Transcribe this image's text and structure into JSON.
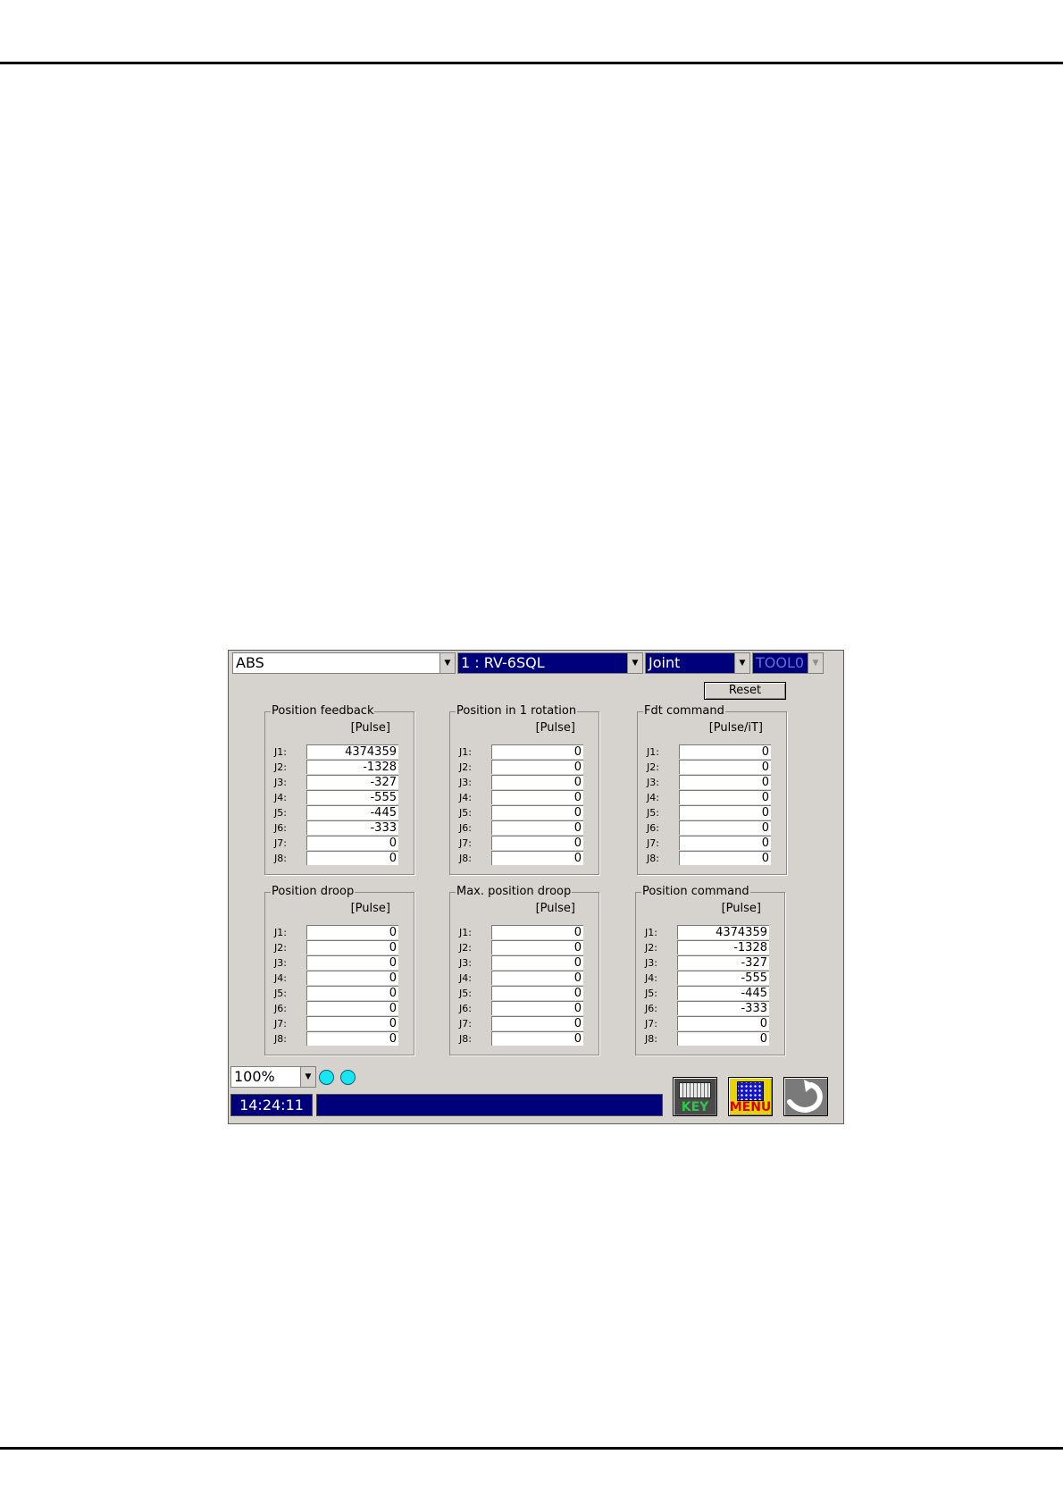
{
  "toolbar": {
    "mode": "ABS",
    "robot": "1 : RV-6SQL",
    "frame": "Joint",
    "tool": "TOOL0"
  },
  "reset_label": "Reset",
  "panels": [
    {
      "title": "Position feedback",
      "unit": "[Pulse]",
      "rows": [
        {
          "label": "J1:",
          "value": "4374359"
        },
        {
          "label": "J2:",
          "value": "-1328"
        },
        {
          "label": "J3:",
          "value": "-327"
        },
        {
          "label": "J4:",
          "value": "-555"
        },
        {
          "label": "J5:",
          "value": "-445"
        },
        {
          "label": "J6:",
          "value": "-333"
        },
        {
          "label": "J7:",
          "value": "0"
        },
        {
          "label": "J8:",
          "value": "0"
        }
      ]
    },
    {
      "title": "Position in 1 rotation",
      "unit": "[Pulse]",
      "rows": [
        {
          "label": "J1:",
          "value": "0"
        },
        {
          "label": "J2:",
          "value": "0"
        },
        {
          "label": "J3:",
          "value": "0"
        },
        {
          "label": "J4:",
          "value": "0"
        },
        {
          "label": "J5:",
          "value": "0"
        },
        {
          "label": "J6:",
          "value": "0"
        },
        {
          "label": "J7:",
          "value": "0"
        },
        {
          "label": "J8:",
          "value": "0"
        }
      ]
    },
    {
      "title": "Fdt command",
      "unit": "[Pulse/iT]",
      "rows": [
        {
          "label": "J1:",
          "value": "0"
        },
        {
          "label": "J2:",
          "value": "0"
        },
        {
          "label": "J3:",
          "value": "0"
        },
        {
          "label": "J4:",
          "value": "0"
        },
        {
          "label": "J5:",
          "value": "0"
        },
        {
          "label": "J6:",
          "value": "0"
        },
        {
          "label": "J7:",
          "value": "0"
        },
        {
          "label": "J8:",
          "value": "0"
        }
      ]
    },
    {
      "title": "Position droop",
      "unit": "[Pulse]",
      "rows": [
        {
          "label": "J1:",
          "value": "0"
        },
        {
          "label": "J2:",
          "value": "0"
        },
        {
          "label": "J3:",
          "value": "0"
        },
        {
          "label": "J4:",
          "value": "0"
        },
        {
          "label": "J5:",
          "value": "0"
        },
        {
          "label": "J6:",
          "value": "0"
        },
        {
          "label": "J7:",
          "value": "0"
        },
        {
          "label": "J8:",
          "value": "0"
        }
      ]
    },
    {
      "title": "Max. position droop",
      "unit": "[Pulse]",
      "rows": [
        {
          "label": "J1:",
          "value": "0"
        },
        {
          "label": "J2:",
          "value": "0"
        },
        {
          "label": "J3:",
          "value": "0"
        },
        {
          "label": "J4:",
          "value": "0"
        },
        {
          "label": "J5:",
          "value": "0"
        },
        {
          "label": "J6:",
          "value": "0"
        },
        {
          "label": "J7:",
          "value": "0"
        },
        {
          "label": "J8:",
          "value": "0"
        }
      ]
    },
    {
      "title": "Position command",
      "unit": "[Pulse]",
      "rows": [
        {
          "label": "J1:",
          "value": "4374359"
        },
        {
          "label": "J2:",
          "value": "-1328"
        },
        {
          "label": "J3:",
          "value": "-327"
        },
        {
          "label": "J4:",
          "value": "-555"
        },
        {
          "label": "J5:",
          "value": "-445"
        },
        {
          "label": "J6:",
          "value": "-333"
        },
        {
          "label": "J7:",
          "value": "0"
        },
        {
          "label": "J8:",
          "value": "0"
        }
      ]
    }
  ],
  "status": {
    "override": "100%",
    "time": "14:24:11",
    "message": ""
  },
  "buttons": {
    "key_label": "KEY",
    "menu_label": "MENU"
  },
  "icons": {
    "dropdown": "chevron-down-icon",
    "status_lamp": "status-lamp-icon",
    "keyboard": "keyboard-icon",
    "menu": "menu-icon",
    "back": "return-arrow-icon"
  },
  "colors": {
    "screen_bg": "#d6d3ce",
    "selection_bar": "#00007a",
    "lamp": "#19e6f5",
    "key_caption": "#2ec84a",
    "menu_caption": "#d80000",
    "menu_button": "#e6d300"
  }
}
